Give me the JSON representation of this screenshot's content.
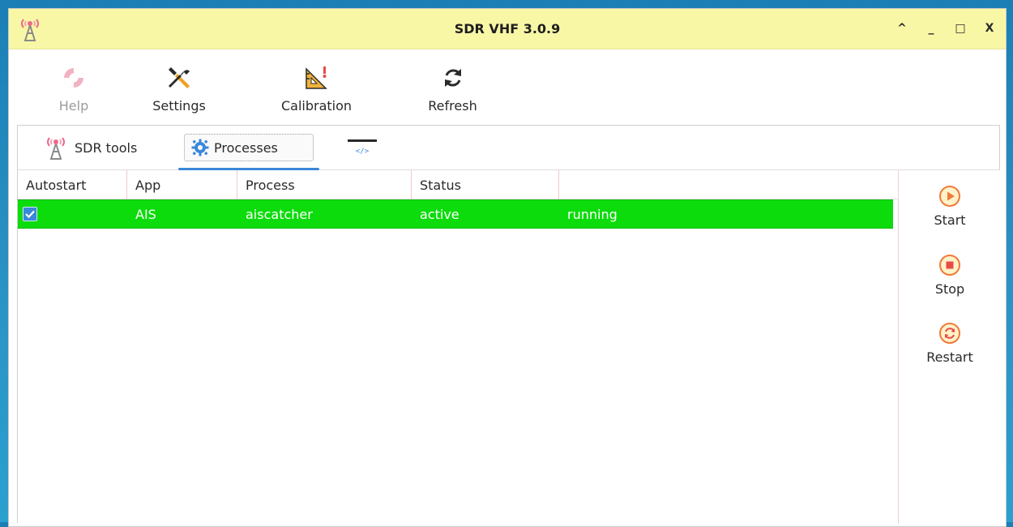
{
  "window": {
    "title": "SDR VHF 3.0.9"
  },
  "window_controls": {
    "collapse": "^",
    "minimize": "_",
    "maximize": "□",
    "close": "X"
  },
  "toolbar": {
    "items": [
      {
        "label": "Help",
        "icon": "lifebuoy-icon",
        "enabled": false
      },
      {
        "label": "Settings",
        "icon": "tools-icon",
        "enabled": true
      },
      {
        "label": "Calibration",
        "icon": "calibration-triangle-icon",
        "enabled": true
      },
      {
        "label": "Refresh",
        "icon": "refresh-icon",
        "enabled": true
      }
    ]
  },
  "tabs": [
    {
      "label": "SDR tools",
      "icon": "antenna-icon"
    },
    {
      "label": "Processes",
      "icon": "gear-icon",
      "selected": true
    },
    {
      "label": "",
      "icon": "code-icon"
    }
  ],
  "table": {
    "columns": [
      "Autostart",
      "App",
      "Process",
      "Status",
      ""
    ],
    "rows": [
      {
        "autostart": true,
        "app": "AIS",
        "process": "aiscatcher",
        "status": "active",
        "state": "running",
        "row_color": "#0cdc0c"
      }
    ]
  },
  "actions": [
    {
      "label": "Start",
      "icon": "play-icon"
    },
    {
      "label": "Stop",
      "icon": "stop-icon"
    },
    {
      "label": "Restart",
      "icon": "restart-icon"
    }
  ],
  "colors": {
    "titlebar": "#f8f7a6",
    "accent": "#3a88d8",
    "desktop": "#2b94c6",
    "action_icon": "#f07a3a"
  }
}
